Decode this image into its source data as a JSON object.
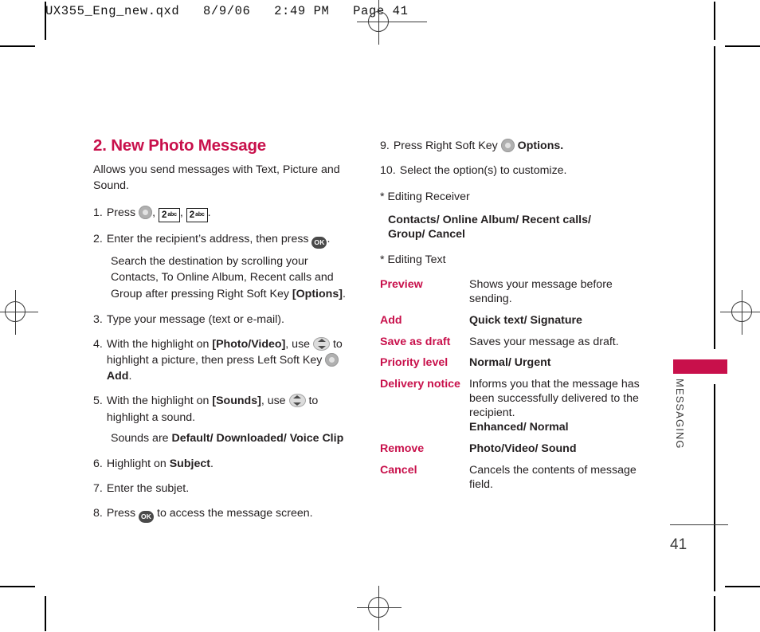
{
  "prepress": {
    "header_line": "UX355_Eng_new.qxd   8/9/06   2:49 PM   Page 41",
    "registration_mark_name": "registration-mark"
  },
  "section": {
    "title": "2. New Photo Message",
    "intro": "Allows you send messages with Text, Picture and Sound."
  },
  "left_column": {
    "steps": [
      {
        "num": "1.",
        "pre": "Press",
        "post": ".",
        "icons": [
          "soft-key",
          "key-2abc",
          "key-2abc"
        ]
      },
      {
        "num": "2.",
        "pre": "Enter the recipient’s address, then press",
        "post": ".",
        "icons": [
          "ok-key"
        ],
        "sub_parts": [
          {
            "text": "Search the destination by scrolling your Contacts, To Online Album, Recent calls and Group after pressing Right Soft Key ",
            "bold": false
          },
          {
            "text": "[Options]",
            "bold": true
          },
          {
            "text": ".",
            "bold": false
          }
        ]
      },
      {
        "num": "3.",
        "text": "Type your message (text or e-mail)."
      },
      {
        "num": "4.",
        "parts": [
          {
            "text": "With the highlight on ",
            "bold": false
          },
          {
            "text": "[Photo/Video]",
            "bold": true
          },
          {
            "text": ", use ",
            "bold": false
          },
          {
            "icon": "nav-key"
          },
          {
            "text": " to highlight a picture, then press Left Soft Key ",
            "bold": false
          },
          {
            "icon": "soft-key"
          },
          {
            "text": " ",
            "bold": false
          },
          {
            "text": "Add",
            "bold": true
          },
          {
            "text": ".",
            "bold": false
          }
        ]
      },
      {
        "num": "5.",
        "parts": [
          {
            "text": "With the highlight on ",
            "bold": false
          },
          {
            "text": "[Sounds]",
            "bold": true
          },
          {
            "text": ", use ",
            "bold": false
          },
          {
            "icon": "nav-key"
          },
          {
            "text": " to highlight a sound.",
            "bold": false
          }
        ],
        "sub_parts": [
          {
            "text": "Sounds are ",
            "bold": false
          },
          {
            "text": "Default/ Downloaded/ Voice Clip",
            "bold": true
          }
        ]
      },
      {
        "num": "6.",
        "parts": [
          {
            "text": "Highlight on ",
            "bold": false
          },
          {
            "text": "Subject",
            "bold": true
          },
          {
            "text": ".",
            "bold": false
          }
        ]
      },
      {
        "num": "7.",
        "text": "Enter the subjet."
      },
      {
        "num": "8.",
        "pre": "Press",
        "post": "to access the message screen.",
        "icons": [
          "ok-key"
        ]
      }
    ]
  },
  "right_column": {
    "steps": [
      {
        "num": "9.",
        "pre": "Press Right Soft Key",
        "post": "Options.",
        "icons": [
          "soft-key"
        ]
      },
      {
        "num": "10.",
        "text": "Select the option(s) to customize."
      }
    ],
    "editing_receiver": {
      "heading": "* Editing Receiver",
      "values": "Contacts/ Online Album/ Recent calls/ Group/ Cancel"
    },
    "editing_text": {
      "heading": "* Editing Text",
      "rows": [
        {
          "key": "Preview",
          "value": "Shows your message before sending.",
          "bold_value": false
        },
        {
          "key": "Add",
          "value": "Quick text/ Signature",
          "bold_value": true
        },
        {
          "key": "Save as draft",
          "value": "Saves your message as draft.",
          "bold_value": false
        },
        {
          "key": "Priority level",
          "value": "Normal/ Urgent",
          "bold_value": true
        },
        {
          "key": "Delivery notice",
          "value": "Informs you that the message has been successfully delivered to the recipient.",
          "bold_value": false,
          "extra_bold": "Enhanced/ Normal"
        },
        {
          "key": "Remove",
          "value": "Photo/Video/ Sound",
          "bold_value": true
        },
        {
          "key": "Cancel",
          "value": "Cancels the contents of message field.",
          "bold_value": false
        }
      ]
    }
  },
  "chapter": {
    "label": "MESSAGING",
    "tab_color": "#c8104b"
  },
  "footer": {
    "page_number": "41"
  },
  "icon_glyphs": {
    "ok_label": "OK",
    "key_2_number": "2",
    "key_2_letters": "abc"
  }
}
